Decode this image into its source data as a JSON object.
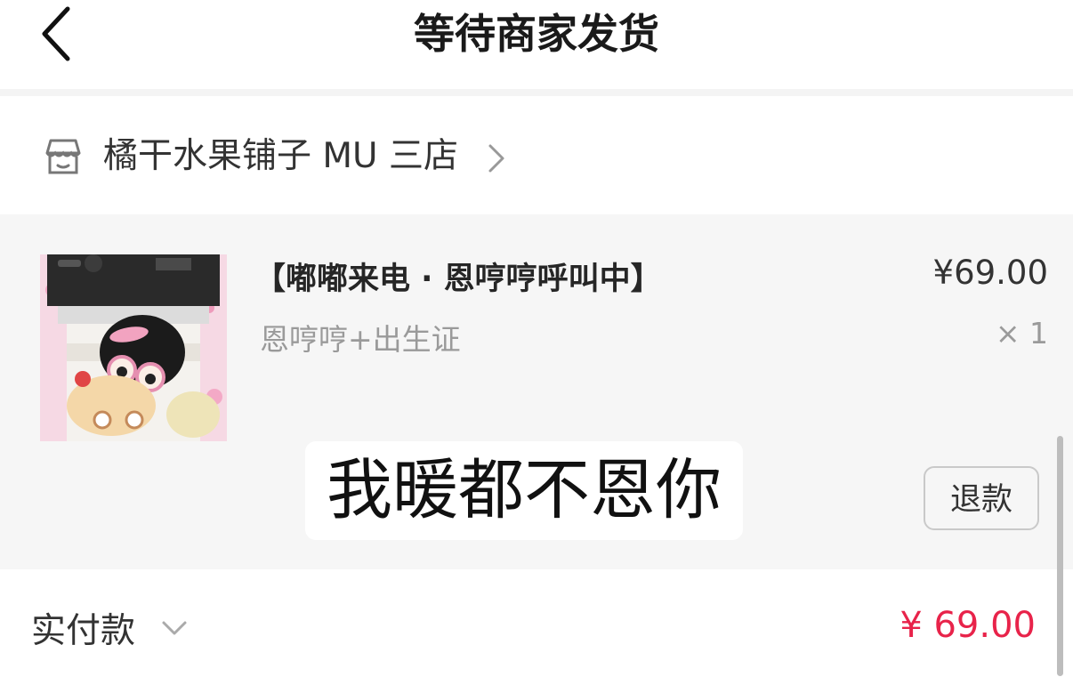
{
  "header": {
    "title": "等待商家发货",
    "back_icon": "chevron-left-icon"
  },
  "shop": {
    "name": "橘干水果铺子 MU 三店",
    "icon": "store-icon",
    "chevron_icon": "chevron-right-icon"
  },
  "order_item": {
    "title": "【嘟嘟来电 · 恩哼哼呼叫中】",
    "variant": "恩哼哼+出生证",
    "price": "¥69.00",
    "quantity": "× 1",
    "refund_label": "退款",
    "image": "product-photo"
  },
  "overlay_caption": "我暖都不恩你",
  "total": {
    "label": "实付款",
    "amount": "¥ 69.00",
    "amount_color": "#e8234a",
    "expand_icon": "chevron-down-icon"
  }
}
